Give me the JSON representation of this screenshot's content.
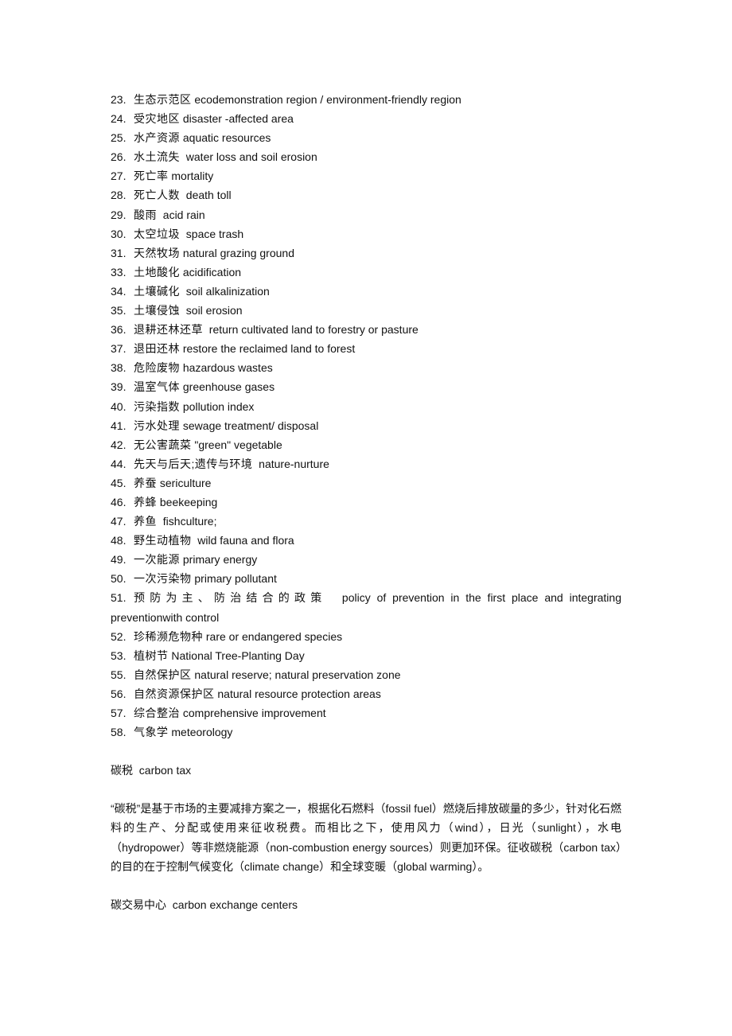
{
  "glossary": [
    {
      "num": "23.",
      "zh": "生态示范区",
      "en": "ecodemonstration region / environment-friendly region"
    },
    {
      "num": "24.",
      "zh": "受灾地区",
      "en": "disaster -affected area"
    },
    {
      "num": "25.",
      "zh": "水产资源",
      "en": "aquatic resources"
    },
    {
      "num": "26.",
      "zh": "水土流失",
      "en": " water loss and soil erosion"
    },
    {
      "num": "27.",
      "zh": "死亡率",
      "en": "mortality"
    },
    {
      "num": "28.",
      "zh": "死亡人数",
      "en": " death toll"
    },
    {
      "num": "29.",
      "zh": "酸雨",
      "en": " acid rain"
    },
    {
      "num": "30.",
      "zh": "太空垃圾",
      "en": " space trash"
    },
    {
      "num": "31.",
      "zh": "天然牧场",
      "en": "natural grazing ground"
    },
    {
      "num": "33.",
      "zh": "土地酸化",
      "en": "acidification"
    },
    {
      "num": "34.",
      "zh": "土壤碱化",
      "en": " soil alkalinization"
    },
    {
      "num": "35.",
      "zh": "土壤侵蚀",
      "en": " soil erosion"
    },
    {
      "num": "36.",
      "zh": "退耕还林还草",
      "en": " return cultivated land to forestry or pasture"
    },
    {
      "num": "37.",
      "zh": "退田还林",
      "en": "restore the reclaimed land to forest"
    },
    {
      "num": "38.",
      "zh": "危险废物",
      "en": "hazardous wastes"
    },
    {
      "num": "39.",
      "zh": "温室气体",
      "en": "greenhouse gases"
    },
    {
      "num": "40.",
      "zh": "污染指数",
      "en": "pollution index"
    },
    {
      "num": "41.",
      "zh": "污水处理",
      "en": "sewage treatment/ disposal"
    },
    {
      "num": "42.",
      "zh": "无公害蔬菜",
      "en": "\"green\" vegetable"
    },
    {
      "num": "44.",
      "zh": "先天与后天;遗传与环境",
      "en": " nature-nurture"
    },
    {
      "num": "45.",
      "zh": "养蚕",
      "en": "sericulture"
    },
    {
      "num": "46.",
      "zh": "养蜂",
      "en": "beekeeping"
    },
    {
      "num": "47.",
      "zh": "养鱼",
      "en": " fishculture;"
    },
    {
      "num": "48.",
      "zh": "野生动植物",
      "en": " wild fauna and flora"
    },
    {
      "num": "49.",
      "zh": "一次能源",
      "en": "primary energy"
    },
    {
      "num": "50.",
      "zh": "一次污染物",
      "en": "primary pollutant"
    }
  ],
  "item51": {
    "num": "51.",
    "zh": "预防为主、防治结合的政策",
    "en_line1": "policy of prevention in the first place and integrating",
    "en_line2": "preventionwith control"
  },
  "glossary2": [
    {
      "num": "52.",
      "zh": "珍稀濒危物种",
      "en": "rare or endangered species"
    },
    {
      "num": "53.",
      "zh": "植树节",
      "en": "National Tree-Planting Day"
    },
    {
      "num": "55.",
      "zh": "自然保护区",
      "en": "natural reserve; natural preservation zone"
    },
    {
      "num": "56.",
      "zh": "自然资源保护区",
      "en": "natural resource protection areas"
    },
    {
      "num": "57.",
      "zh": "综合整治",
      "en": "comprehensive improvement"
    },
    {
      "num": "58.",
      "zh": "气象学",
      "en": "meteorology"
    }
  ],
  "carbon_tax": {
    "heading": "碳税  carbon tax",
    "paragraph": "“碳税”是基于市场的主要减排方案之一，根据化石燃料（fossil fuel）燃烧后排放碳量的多少，针对化石燃料的生产、分配或使用来征收税费。而相比之下，使用风力（wind），日光（sunlight），水电（hydropower）等非燃烧能源（non-combustion energy sources）则更加环保。征收碳税（carbon tax）的目的在于控制气候变化（climate change）和全球变暖（global warming）。"
  },
  "carbon_exchange": {
    "heading": "碳交易中心  carbon exchange centers"
  }
}
